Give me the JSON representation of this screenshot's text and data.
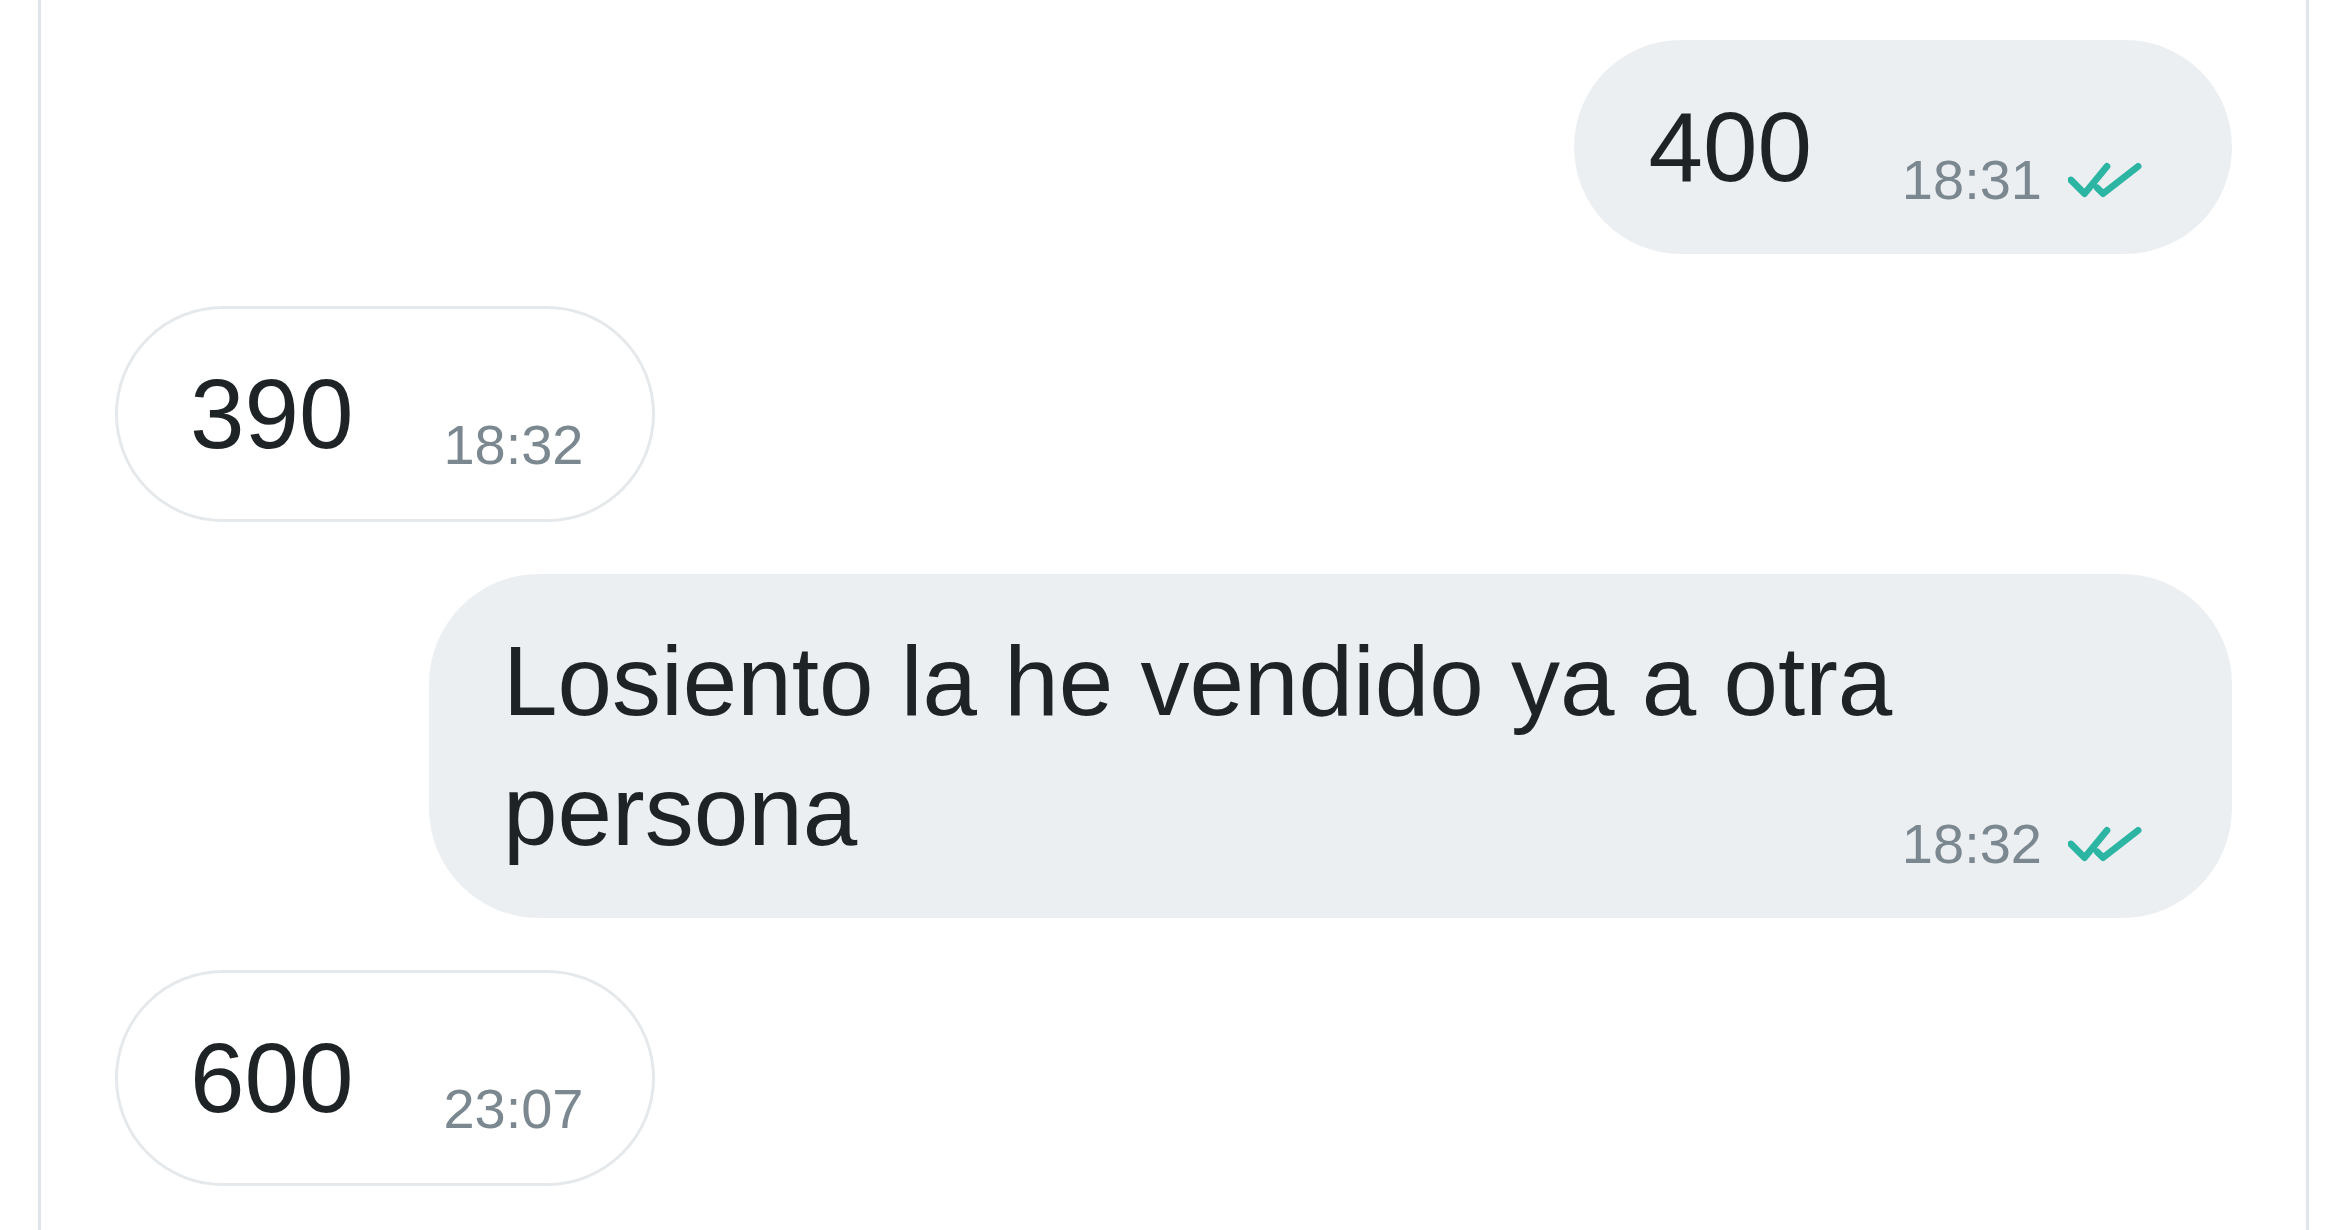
{
  "messages": [
    {
      "kind": "sent",
      "text": "400",
      "time": "18:31",
      "read": true
    },
    {
      "kind": "received",
      "text": "390",
      "time": "18:32"
    },
    {
      "kind": "sent",
      "text": "Losiento la he vendido ya a otra persona",
      "time": "18:32",
      "read": true
    },
    {
      "kind": "received",
      "text": "600",
      "time": "23:07"
    }
  ]
}
